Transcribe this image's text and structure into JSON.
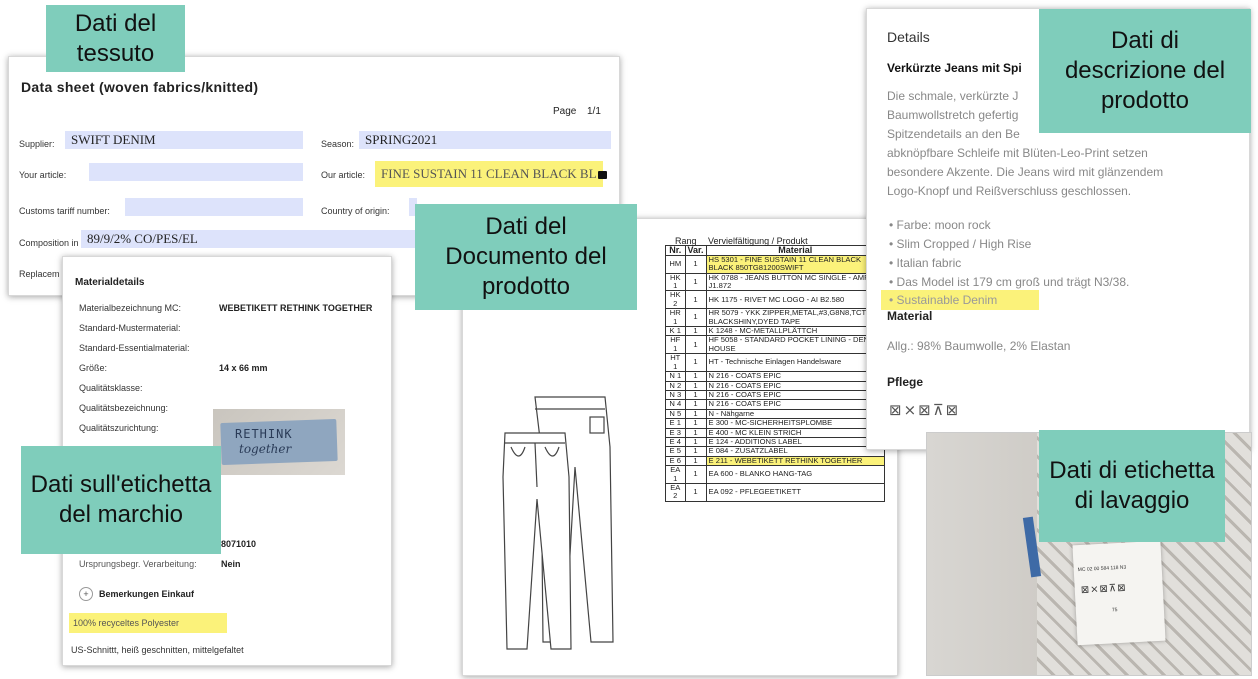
{
  "callouts": {
    "fabric": "Dati del tessuto",
    "description": "Dati di descrizione del prodotto",
    "document": "Dati del Documento del prodotto",
    "brand_label": "Dati sull'etichetta del marchio",
    "wash_label": "Dati di etichetta di lavaggio"
  },
  "datasheet": {
    "title": "Data sheet (woven fabrics/knitted)",
    "page_label": "Page",
    "page_value": "1/1",
    "supplier_label": "Supplier:",
    "supplier_value": "SWIFT DENIM",
    "season_label": "Season:",
    "season_value": "SPRING2021",
    "your_article_label": "Your article:",
    "your_article_value": "",
    "our_article_label": "Our article:",
    "our_article_value": "FINE SUSTAIN 11 CLEAN BLACK BL",
    "customs_label": "Customs tariff number:",
    "country_label": "Country of origin:",
    "composition_label": "Composition in %:",
    "composition_value": "89/9/2% CO/PES/EL",
    "replacement_label": "Replacem"
  },
  "material": {
    "title": "Materialdetails",
    "rows": [
      {
        "label": "Materialbezeichnung MC:",
        "value": "WEBETIKETT RETHINK TOGETHER"
      },
      {
        "label": "Standard-Mustermaterial:",
        "value": ""
      },
      {
        "label": "Standard-Essentialmaterial:",
        "value": ""
      },
      {
        "label": "Größe:",
        "value": "14 x 66 mm"
      },
      {
        "label": "Qualitätsklasse:",
        "value": ""
      },
      {
        "label": "Qualitätsbezeichnung:",
        "value": ""
      },
      {
        "label": "Qualitätszurichtung:",
        "value": ""
      }
    ],
    "label_text_1": "RETHINK",
    "label_text_2": "together",
    "number_fragment": "8071010",
    "origin_label": "Ursprungsbegr. Verarbeitung:",
    "origin_value": "Nein",
    "bemerkungen": "Bemerkungen Einkauf",
    "recycled": "100% recyceltes Polyester",
    "cut": "US-Schnittt, heiß geschnitten, mittelgefaltet"
  },
  "bom": {
    "header_rang": "Rang",
    "header_vervielf": "Vervielfältigung / Produkt",
    "col_nr": "Nr.",
    "col_var": "Var.",
    "col_material": "Material",
    "rows": [
      {
        "nr": "HM",
        "var": "1",
        "material": "HS 5301 - FINE SUSTAIN 11 CLEAN BLACK BLACK 850TG81200SWIFT",
        "hl": true
      },
      {
        "nr": "HK 1",
        "var": "1",
        "material": "HK 0788 - JEANS BUTTON MC SINGLE - AMF J1.872",
        "hl": false
      },
      {
        "nr": "HK 2",
        "var": "1",
        "material": "HK 1175 - RIVET MC LOGO - AI B2.580",
        "hl": false
      },
      {
        "nr": "HR 1",
        "var": "1",
        "material": "HR 5079 - YKK ZIPPER,METAL,#3,G8N8,TCT BLACKSHINY,DYED TAPE",
        "hl": false
      },
      {
        "nr": "K 1",
        "var": "1",
        "material": "K 1248 - MC-METALLPLÄTTCH",
        "hl": false
      },
      {
        "nr": "HF 1",
        "var": "1",
        "material": "HF 5058 - STANDARD POCKET LINING - DENIM HOUSE",
        "hl": false
      },
      {
        "nr": "HT 1",
        "var": "1",
        "material": "HT - Technische Einlagen Handelsware",
        "hl": false
      },
      {
        "nr": "N 1",
        "var": "1",
        "material": "N 216 - COATS EPIC",
        "hl": false
      },
      {
        "nr": "N 2",
        "var": "1",
        "material": "N 216 - COATS EPIC",
        "hl": false
      },
      {
        "nr": "N 3",
        "var": "1",
        "material": "N 216 - COATS EPIC",
        "hl": false
      },
      {
        "nr": "N 4",
        "var": "1",
        "material": "N 216 - COATS EPIC",
        "hl": false
      },
      {
        "nr": "N 5",
        "var": "1",
        "material": "N - Nähgarne",
        "hl": false
      },
      {
        "nr": "E 1",
        "var": "1",
        "material": "E 300 - MC-SICHERHEITSPLOMBE",
        "hl": false
      },
      {
        "nr": "E 3",
        "var": "1",
        "material": "E 400 - MC KLEIN STRICH",
        "hl": false
      },
      {
        "nr": "E 4",
        "var": "1",
        "material": "E 124 - ADDITIONS LABEL",
        "hl": false
      },
      {
        "nr": "E 5",
        "var": "1",
        "material": "E 084 - ZUSATZLABEL",
        "hl": false
      },
      {
        "nr": "E 6",
        "var": "1",
        "material": "E 211 - WEBETIKETT RETHINK TOGETHER",
        "hl": true
      },
      {
        "nr": "EA 1",
        "var": "1",
        "material": "EA 600 - BLANKO HANG-TAG",
        "hl": false
      },
      {
        "nr": "EA 2",
        "var": "1",
        "material": "EA 092 - PFLEGEETIKETT",
        "hl": false
      }
    ]
  },
  "details": {
    "title": "Details",
    "product_title": "Verkürzte Jeans mit Spi",
    "description_lines": [
      "Die schmale, verkürzte J",
      "Baumwollstretch gefertig",
      "Spitzendetails an den Be",
      "abknöpfbare Schleife mit Blüten-Leo-Print setzen",
      "besondere Akzente. Die Jeans wird mit glänzendem",
      "Logo-Knopf und Reißverschluss geschlossen."
    ],
    "bullets": [
      "Farbe: moon rock",
      "Slim Cropped / High Rise",
      "Italian fabric",
      "Das Model ist 179 cm groß und trägt N3/38."
    ],
    "sustainable": "Sustainable Denim",
    "material_title": "Material",
    "material_text": "Allg.: 98% Baumwolle, 2% Elastan",
    "care_title": "Pflege",
    "care_symbols": "⊠⨯⊠⊼⊠"
  },
  "washlabel": {
    "text_top": "MC 02 00 584   118   N3",
    "text_3": "75"
  },
  "colors": {
    "callout": "#7fcdbb",
    "field": "#dde3fb",
    "highlight": "#fbf27a"
  }
}
